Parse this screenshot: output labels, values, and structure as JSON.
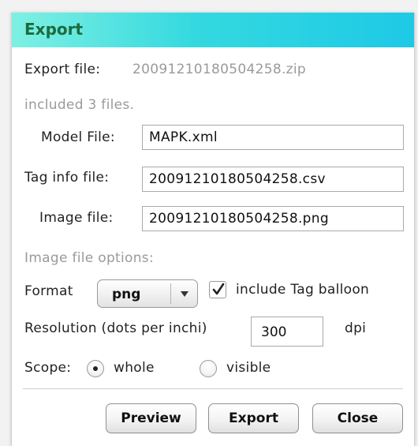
{
  "dialog": {
    "title": "Export",
    "accent_color": "#34d9df",
    "title_color": "#1d6b3c"
  },
  "export_file": {
    "label": "Export file:",
    "value": "20091210180504258.zip"
  },
  "included_files_text": "included 3 files.",
  "model_file": {
    "label": "Model File:",
    "value": "MAPK.xml"
  },
  "tag_info_file": {
    "label": "Tag info file:",
    "value": "20091210180504258.csv"
  },
  "image_file": {
    "label": "Image file:",
    "value": "20091210180504258.png"
  },
  "image_options_heading": "Image file options:",
  "format": {
    "label": "Format",
    "selected": "png",
    "icon": "chevron-down-icon"
  },
  "include_tag_balloon": {
    "label": "include Tag balloon",
    "checked": true,
    "icon": "checkmark-icon"
  },
  "resolution": {
    "label": "Resolution (dots per inchi)",
    "value": "300",
    "unit": "dpi"
  },
  "scope": {
    "label": "Scope:",
    "options": [
      {
        "label": "whole",
        "selected": true
      },
      {
        "label": "visible",
        "selected": false
      }
    ]
  },
  "buttons": {
    "preview": "Preview",
    "export": "Export",
    "close": "Close"
  }
}
